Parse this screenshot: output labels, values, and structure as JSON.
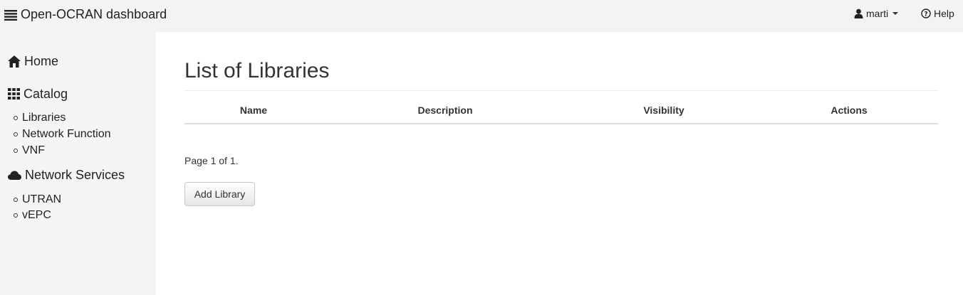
{
  "app": {
    "title": "Open-OCRAN dashboard",
    "menu_icon": "hamburger-menu-icon"
  },
  "navbar": {
    "user": {
      "label": "marti",
      "icon": "user-icon"
    },
    "help": {
      "label": "Help",
      "icon": "question-circle-icon"
    }
  },
  "sidebar": {
    "sections": [
      {
        "label": "Home",
        "icon": "home-icon",
        "items": []
      },
      {
        "label": "Catalog",
        "icon": "grid-icon",
        "items": [
          "Libraries",
          "Network Function",
          "VNF"
        ]
      },
      {
        "label": "Network Services",
        "icon": "cloud-icon",
        "items": [
          "UTRAN",
          "vEPC"
        ]
      }
    ]
  },
  "main": {
    "title": "List of Libraries",
    "table": {
      "columns": [
        "Name",
        "Description",
        "Visibility",
        "Actions"
      ],
      "rows": []
    },
    "pagination": "Page 1 of 1.",
    "add_button": "Add Library"
  }
}
